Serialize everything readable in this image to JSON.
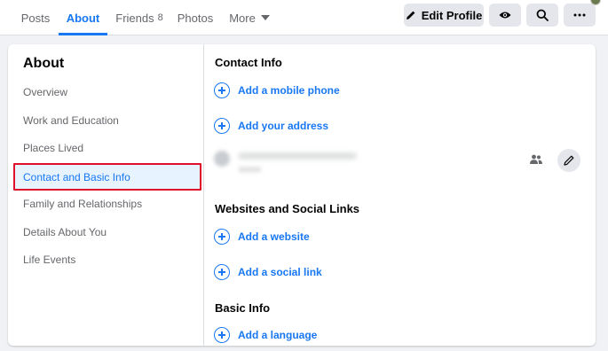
{
  "nav": {
    "tabs": [
      {
        "label": "Posts"
      },
      {
        "label": "About"
      },
      {
        "label": "Friends",
        "count": "8"
      },
      {
        "label": "Photos"
      },
      {
        "label": "More"
      }
    ],
    "edit_profile_label": "Edit Profile",
    "icons": [
      "pencil-icon",
      "eye-icon",
      "search-icon",
      "ellipsis-icon"
    ]
  },
  "sidebar": {
    "title": "About",
    "items": [
      {
        "label": "Overview"
      },
      {
        "label": "Work and Education"
      },
      {
        "label": "Places Lived"
      },
      {
        "label": "Contact and Basic Info",
        "selected": true
      },
      {
        "label": "Family and Relationships"
      },
      {
        "label": "Details About You"
      },
      {
        "label": "Life Events"
      }
    ]
  },
  "content": {
    "contact": {
      "title": "Contact Info",
      "add_phone": "Add a mobile phone",
      "add_address": "Add your address",
      "email_value": "xxxxxxxxxxxxxxxxxxxxxxxx",
      "email_sub": "xxxxx"
    },
    "websites": {
      "title": "Websites and Social Links",
      "add_website": "Add a website",
      "add_social": "Add a social link"
    },
    "basic": {
      "title": "Basic Info",
      "add_language": "Add a language"
    }
  },
  "colors": {
    "accent": "#1877f2",
    "highlight_border": "#e0102a",
    "selected_bg": "#e7f3ff"
  }
}
